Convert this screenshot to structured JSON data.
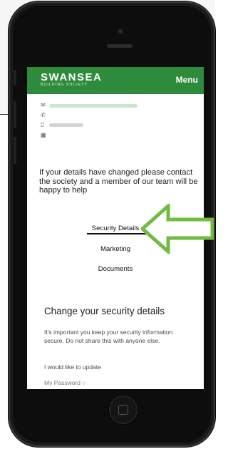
{
  "header": {
    "logo_main": "SWANSEA",
    "logo_sub": "BUILDING SOCIETY",
    "menu_label": "Menu"
  },
  "contact": {
    "icons": [
      "email-icon",
      "phone-icon",
      "mobile-icon",
      "fax-icon"
    ]
  },
  "info_text": "If your details have changed please contact the society and a member of our team will be happy to help",
  "links": {
    "security": "Security Details",
    "marketing": "Marketing",
    "documents": "Documents"
  },
  "security": {
    "title": "Change your security details",
    "body": "It's important you keep your security information secure. Do not share this with anyone else.",
    "update": "I would like to update",
    "password": "My Password"
  },
  "colors": {
    "brand_green": "#2d8b3b",
    "arrow_green": "#71bb43"
  }
}
